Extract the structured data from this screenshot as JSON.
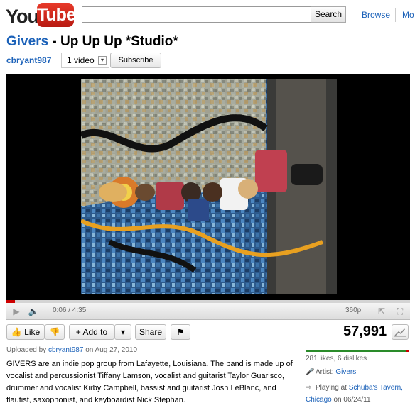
{
  "header": {
    "logo_you": "You",
    "logo_tube": "Tube",
    "search_placeholder": "",
    "search_button": "Search",
    "nav_browse": "Browse",
    "nav_more": "Mo"
  },
  "video": {
    "title_artist": "Givers",
    "title_rest": " - Up Up Up *Studio*",
    "channel": "cbryant987",
    "video_count": "1 video",
    "subscribe": "Subscribe"
  },
  "player": {
    "time": "0:06 / 4:35",
    "quality": "360p",
    "progress": 0.022
  },
  "actions": {
    "like": "Like",
    "add_to": "Add to",
    "share": "Share",
    "views": "57,991"
  },
  "description": {
    "uploaded_prefix": "Uploaded by ",
    "uploader": "cbryant987",
    "uploaded_suffix": " on Aug 27, 2010",
    "text": "GIVERS are an indie pop group from Lafayette, Louisiana. The band is made up of vocalist and percussionist Tiffany Lamson, vocalist and guitarist Taylor Guarisco, drummer and vocalist Kirby Campbell, bassist and guitarist Josh LeBlanc, and flautist, saxophonist, and keyboardist Nick Stephan."
  },
  "sidebar": {
    "likes": "281 likes, 6 dislikes",
    "like_ratio": 0.979,
    "artist_label": "Artist: ",
    "artist": "Givers",
    "playing_label": "Playing at ",
    "venue": "Schuba's Tavern, Chicago",
    "date": " on 06/24/11"
  },
  "colors": {
    "link": "#1c62b9",
    "logo_red": "#e83a2a",
    "progress": "#cc0000",
    "like_green": "#2a8b2a"
  }
}
